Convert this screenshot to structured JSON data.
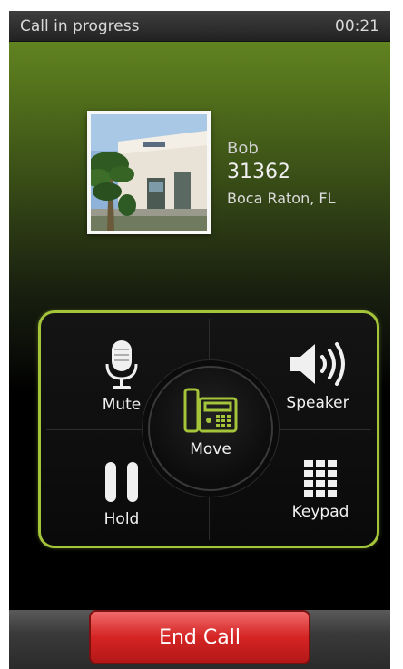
{
  "status_bar": {
    "title": "Call in progress",
    "timer": "00:21"
  },
  "contact": {
    "name": "Bob",
    "number": "31362",
    "location": "Boca Raton, FL"
  },
  "controls": {
    "mute_label": "Mute",
    "speaker_label": "Speaker",
    "move_label": "Move",
    "hold_label": "Hold",
    "keypad_label": "Keypad"
  },
  "end_call_label": "End Call",
  "colors": {
    "accent": "#a4c43a",
    "end_call": "#d52424",
    "background": "#000000"
  },
  "icons": {
    "mute": "microphone-icon",
    "speaker": "speaker-icon",
    "move": "desk-phone-icon",
    "hold": "pause-icon",
    "keypad": "keypad-grid-icon"
  }
}
